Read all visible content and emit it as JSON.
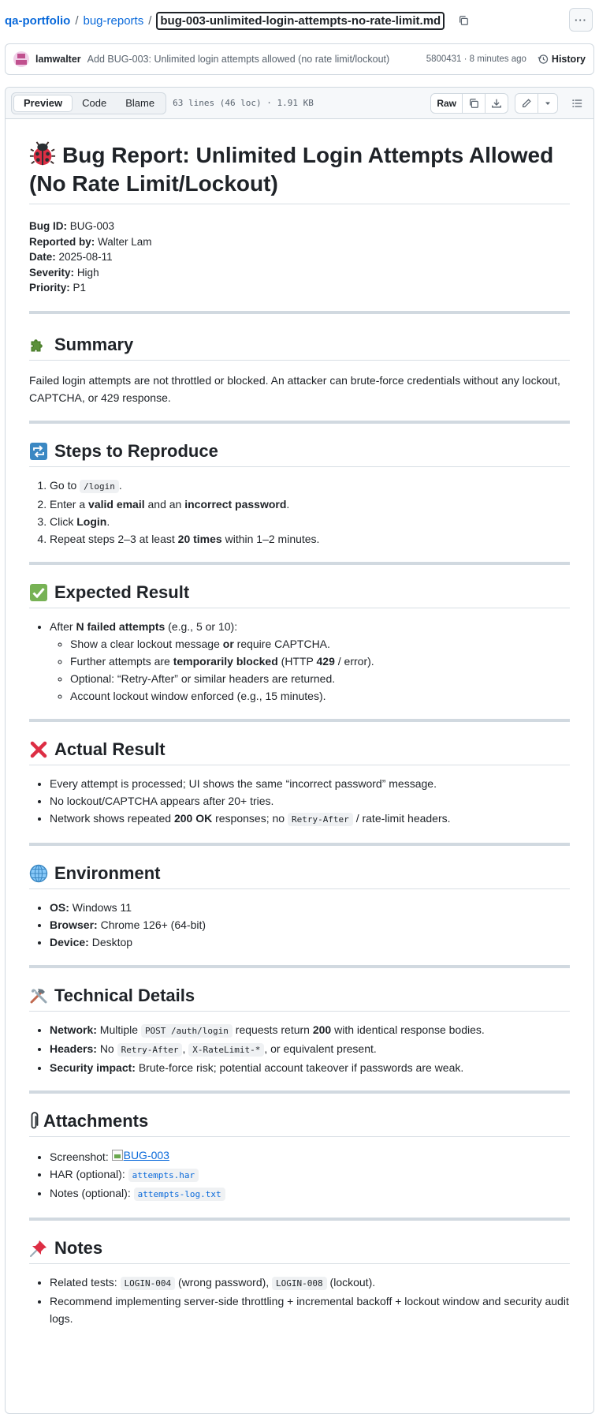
{
  "breadcrumb": {
    "repo": "qa-portfolio",
    "folder": "bug-reports",
    "separator": "/",
    "file": "bug-003-unlimited-login-attempts-no-rate-limit.md",
    "more_label": "···"
  },
  "commit": {
    "author": "lamwalter",
    "message": "Add BUG-003: Unlimited login attempts allowed (no rate limit/lockout)",
    "meta": "5800431 · 8 minutes ago",
    "history_label": "History"
  },
  "toolbar": {
    "tabs": [
      "Preview",
      "Code",
      "Blame"
    ],
    "active_tab": "Preview",
    "file_info": "63 lines (46 loc) · 1.91 KB",
    "raw_label": "Raw"
  },
  "doc": {
    "title": "Bug Report: Unlimited Login Attempts Allowed (No Rate Limit/Lockout)",
    "meta": [
      {
        "label": "Bug ID:",
        "value": "BUG-003"
      },
      {
        "label": "Reported by:",
        "value": "Walter Lam"
      },
      {
        "label": "Date:",
        "value": "2025-08-11"
      },
      {
        "label": "Severity:",
        "value": "High"
      },
      {
        "label": "Priority:",
        "value": "P1"
      }
    ],
    "summary": {
      "heading": "Summary",
      "text": "Failed login attempts are not throttled or blocked. An attacker can brute-force credentials without any lockout, CAPTCHA, or 429 response."
    },
    "steps": {
      "heading": "Steps to Reproduce",
      "s1_pre": "Go to",
      "s1_code": "/login",
      "s1_post": ".",
      "s2_a": "Enter a",
      "s2_b": "valid email",
      "s2_c": "and an",
      "s2_d": "incorrect password",
      "s2_e": ".",
      "s3_a": "Click",
      "s3_b": "Login",
      "s3_c": ".",
      "s4_a": "Repeat steps 2–3 at least",
      "s4_b": "20 times",
      "s4_c": "within 1–2 minutes."
    },
    "expected": {
      "heading": "Expected Result",
      "l1_a": "After",
      "l1_b": "N failed attempts",
      "l1_c": "(e.g., 5 or 10):",
      "sub1_a": "Show a clear lockout message",
      "sub1_b": "or",
      "sub1_c": "require CAPTCHA.",
      "sub2_a": "Further attempts are",
      "sub2_b": "temporarily blocked",
      "sub2_c": "(HTTP",
      "sub2_d": "429",
      "sub2_e": "/ error).",
      "sub3": "Optional: “Retry-After” or similar headers are returned.",
      "sub4": "Account lockout window enforced (e.g., 15 minutes)."
    },
    "actual": {
      "heading": "Actual Result",
      "a1": "Every attempt is processed; UI shows the same “incorrect password” message.",
      "a2": "No lockout/CAPTCHA appears after 20+ tries.",
      "a3_a": "Network shows repeated",
      "a3_b": "200 OK",
      "a3_c": "responses; no",
      "a3_code": "Retry-After",
      "a3_d": "/ rate-limit headers."
    },
    "environment": {
      "heading": "Environment",
      "items": [
        {
          "label": "OS:",
          "value": "Windows 11"
        },
        {
          "label": "Browser:",
          "value": "Chrome 126+ (64-bit)"
        },
        {
          "label": "Device:",
          "value": "Desktop"
        }
      ]
    },
    "technical": {
      "heading": "Technical Details",
      "t1_label": "Network:",
      "t1_a": "Multiple",
      "t1_code": "POST /auth/login",
      "t1_b": "requests return",
      "t1_c": "200",
      "t1_d": "with identical response bodies.",
      "t2_label": "Headers:",
      "t2_a": "No",
      "t2_code1": "Retry-After",
      "t2_sep": ",",
      "t2_code2": "X-RateLimit-*",
      "t2_b": ", or equivalent present.",
      "t3_label": "Security impact:",
      "t3_text": "Brute-force risk; potential account takeover if passwords are weak."
    },
    "attachments": {
      "heading": "Attachments",
      "screenshot_label": "Screenshot:",
      "screenshot_alt": "BUG-003",
      "har_label": "HAR (optional):",
      "har_file": "attempts.har",
      "notes_label": "Notes (optional):",
      "notes_file": "attempts-log.txt"
    },
    "notes": {
      "heading": "Notes",
      "n1_a": "Related tests:",
      "n1_code1": "LOGIN-004",
      "n1_b": "(wrong password),",
      "n1_code2": "LOGIN-008",
      "n1_c": "(lockout).",
      "n2": "Recommend implementing server-side throttling + incremental backoff + lockout window and security audit logs."
    }
  }
}
